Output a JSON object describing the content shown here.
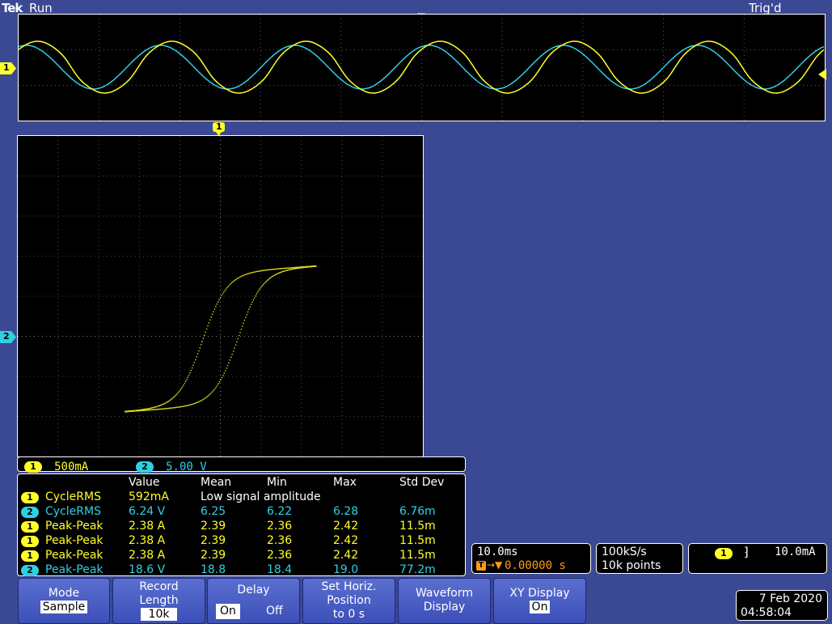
{
  "header": {
    "brand": "Tek",
    "state": "Run",
    "trigger_status": "Trig'd"
  },
  "markers": {
    "trigger": "T",
    "ch1": "1",
    "ch2": "2",
    "xy_top": "1"
  },
  "channel_bar": {
    "ch1_badge": "1",
    "ch1_scale": "500mA",
    "ch2_badge": "2",
    "ch2_scale": "5.00 V"
  },
  "measurements": {
    "columns": [
      "Value",
      "Mean",
      "Min",
      "Max",
      "Std Dev"
    ],
    "rows": [
      {
        "ch": "1",
        "name": "CycleRMS",
        "value": "592mA",
        "note": "Low signal amplitude"
      },
      {
        "ch": "2",
        "name": "CycleRMS",
        "value": "6.24 V",
        "mean": "6.25",
        "min": "6.22",
        "max": "6.28",
        "std": "6.76m"
      },
      {
        "ch": "1",
        "name": "Peak-Peak",
        "value": "2.38 A",
        "mean": "2.39",
        "min": "2.36",
        "max": "2.42",
        "std": "11.5m"
      },
      {
        "ch": "1",
        "name": "Peak-Peak",
        "value": "2.38 A",
        "mean": "2.39",
        "min": "2.36",
        "max": "2.42",
        "std": "11.5m"
      },
      {
        "ch": "1",
        "name": "Peak-Peak",
        "value": "2.38 A",
        "mean": "2.39",
        "min": "2.36",
        "max": "2.42",
        "std": "11.5m"
      },
      {
        "ch": "2",
        "name": "Peak-Peak",
        "value": "18.6 V",
        "mean": "18.8",
        "min": "18.4",
        "max": "19.0",
        "std": "77.2m"
      }
    ]
  },
  "horizontal": {
    "scale": "10.0ms",
    "position": "0.00000 s",
    "pos_icon": "T"
  },
  "acquisition": {
    "rate": "100kS/s",
    "points": "10k points"
  },
  "trigger": {
    "source": "1",
    "level": "10.0mA"
  },
  "softkeys": {
    "mode": {
      "title": "Mode",
      "value": "Sample"
    },
    "record": {
      "title1": "Record",
      "title2": "Length",
      "value": "10k"
    },
    "delay": {
      "title": "Delay",
      "on": "On",
      "off": "Off"
    },
    "set_horiz": {
      "l1": "Set Horiz.",
      "l2": "Position",
      "l3": "to 0 s"
    },
    "waveform": {
      "l1": "Waveform",
      "l2": "Display"
    },
    "xy": {
      "title": "XY Display",
      "value": "On"
    }
  },
  "datetime": {
    "date": "7 Feb  2020",
    "time": "04:58:04"
  },
  "colors": {
    "background": "#3b4894",
    "ch1": "#ffff2a",
    "ch2": "#2ed0e4",
    "trigger": "#ff9a1a"
  }
}
